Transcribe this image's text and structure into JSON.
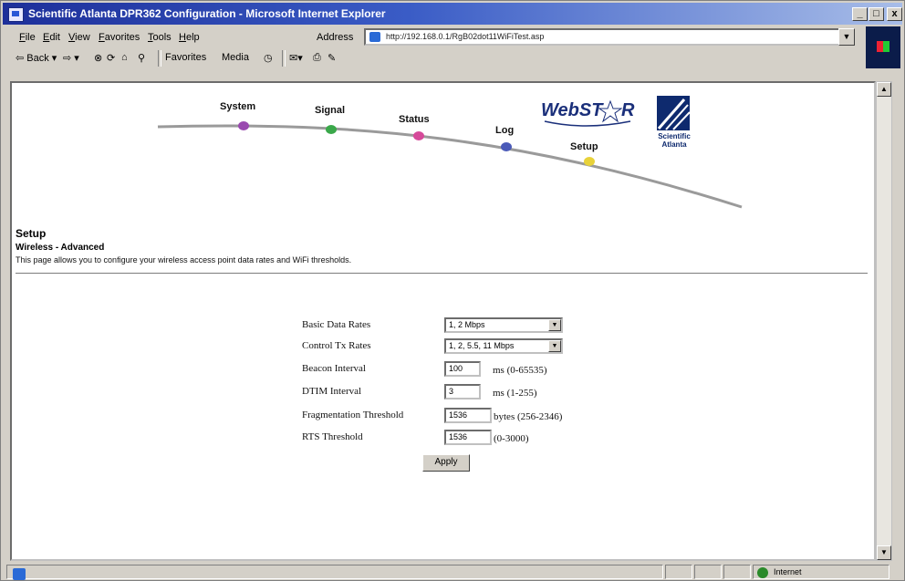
{
  "window": {
    "title": "Scientific Atlanta DPR362 Configuration - Microsoft Internet Explorer",
    "controls": {
      "minimize": "_",
      "maximize": "□",
      "close": "x"
    }
  },
  "menu": [
    "File",
    "Edit",
    "View",
    "Favorites",
    "Tools",
    "Help"
  ],
  "address": {
    "label": "Address",
    "url": "http://192.168.0.1/RgB02dot11WiFiTest.asp"
  },
  "toolbar": {
    "back": "⇦ Back ▾",
    "forward": "⇨ ▾",
    "favorites": "Favorites",
    "media": "Media"
  },
  "nav": {
    "items": [
      {
        "label": "System",
        "color": "#9a4ab0"
      },
      {
        "label": "Signal",
        "color": "#3aa84a"
      },
      {
        "label": "Status",
        "color": "#d64a9a"
      },
      {
        "label": "Log",
        "color": "#4a5ab8"
      },
      {
        "label": "Setup",
        "color": "#e8d23a"
      }
    ]
  },
  "brand": {
    "webstar": "WebSTAR",
    "sa_line1": "Scientific",
    "sa_line2": "Atlanta"
  },
  "page": {
    "title": "Setup",
    "subtitle": "Wireless - Advanced",
    "description": "This page allows you to configure your wireless access point data rates and WiFi thresholds."
  },
  "form": {
    "basic_rates": {
      "label": "Basic Data Rates",
      "value": "1, 2 Mbps"
    },
    "control_tx": {
      "label": "Control Tx Rates",
      "value": "1, 2, 5.5, 11 Mbps"
    },
    "beacon": {
      "label": "Beacon Interval",
      "value": "100",
      "unit": "ms (0-65535)"
    },
    "dtim": {
      "label": "DTIM Interval",
      "value": "3",
      "unit": "ms (1-255)"
    },
    "frag": {
      "label": "Fragmentation Threshold",
      "value": "1536",
      "unit": "bytes (256-2346)"
    },
    "rts": {
      "label": "RTS Threshold",
      "value": "1536",
      "unit": "(0-3000)"
    },
    "apply": "Apply"
  },
  "statusbar": {
    "zone": "Internet"
  }
}
